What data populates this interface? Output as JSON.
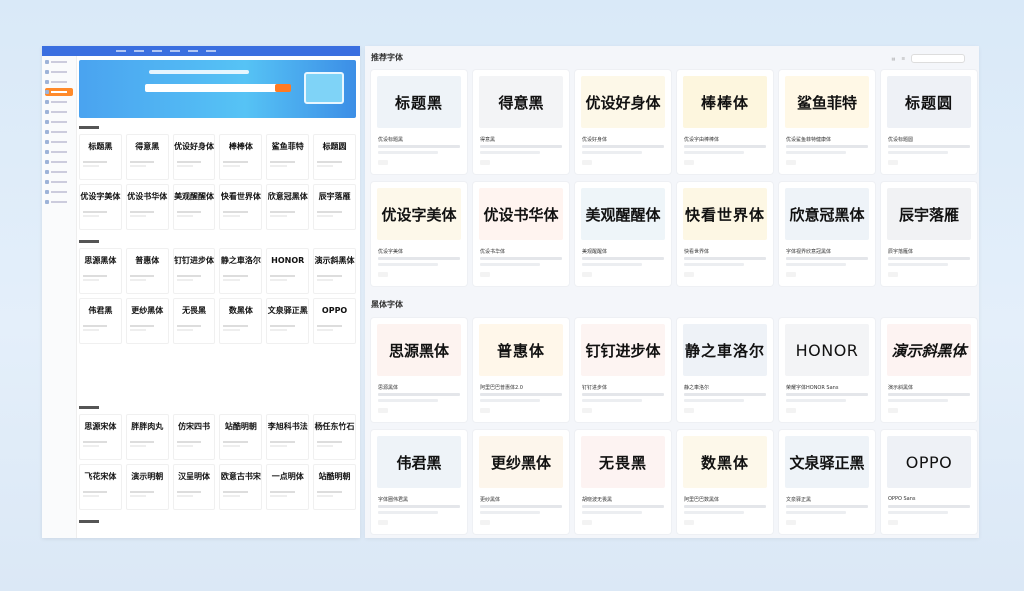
{
  "panel": {
    "section_recommended": "推荐字体",
    "section_heiti": "黑体字体",
    "recommended": [
      {
        "preview": "标题黑",
        "name": "优设标题黑",
        "bg": "#eef3f8",
        "style": "heavy"
      },
      {
        "preview": "得意黑",
        "name": "得意黑",
        "bg": "#f3f4f6",
        "style": "normal"
      },
      {
        "preview": "优设好身体",
        "name": "优设好身体",
        "bg": "#fdf8e8",
        "style": "normal"
      },
      {
        "preview": "棒棒体",
        "name": "优设字由棒棒体",
        "bg": "#fdf6de",
        "style": "heavy"
      },
      {
        "preview": "鲨鱼菲特",
        "name": "优设鲨鱼菲特健康体",
        "bg": "#fff8e6",
        "style": "normal"
      },
      {
        "preview": "标题圆",
        "name": "优设标题圆",
        "bg": "#eef1f6",
        "style": "heavy"
      },
      {
        "preview": "优设字美体",
        "name": "优设字美体",
        "bg": "#fdf8ea",
        "style": "serif"
      },
      {
        "preview": "优设书华体",
        "name": "优设书华体",
        "bg": "#fff4f0",
        "style": "serif"
      },
      {
        "preview": "美观醒醒体",
        "name": "美观醒醒体",
        "bg": "#eef5f9",
        "style": "normal"
      },
      {
        "preview": "快看世界体",
        "name": "快看世界体",
        "bg": "#fdf7e4",
        "style": "heavy"
      },
      {
        "preview": "欣意冠黑体",
        "name": "字体视界欣意冠黑体",
        "bg": "#eef3f8",
        "style": "normal"
      },
      {
        "preview": "辰宇落雁",
        "name": "辰宇落雁体",
        "bg": "#f1f2f4",
        "style": "serif"
      }
    ],
    "heiti": [
      {
        "preview": "思源黑体",
        "name": "思源黑体",
        "bg": "#fdf3f0",
        "style": "normal"
      },
      {
        "preview": "普惠体",
        "name": "阿里巴巴普惠体2.0",
        "bg": "#fff7ea",
        "style": "heavy"
      },
      {
        "preview": "钉钉进步体",
        "name": "钉钉进步体",
        "bg": "#fdf4f2",
        "style": "normal"
      },
      {
        "preview": "静之車洛尔",
        "name": "静之車洛尔",
        "bg": "#eef2f7",
        "style": "heavy"
      },
      {
        "preview": "HONOR",
        "name": "荣耀字体HONOR Sans",
        "bg": "#f3f4f6",
        "style": "latin"
      },
      {
        "preview": "演示斜黑体",
        "name": "演示斜黑体",
        "bg": "#fdf3f2",
        "style": "italic"
      },
      {
        "preview": "伟君黑",
        "name": "字体圈伟君黑",
        "bg": "#eef3f8",
        "style": "normal"
      },
      {
        "preview": "更纱黑体",
        "name": "更纱黑体",
        "bg": "#fdf6ec",
        "style": "normal"
      },
      {
        "preview": "无畏黑",
        "name": "胡晓波无畏黑",
        "bg": "#fdf3f2",
        "style": "heavy"
      },
      {
        "preview": "数黑体",
        "name": "阿里巴巴数黑体",
        "bg": "#fdf8ea",
        "style": "heavy"
      },
      {
        "preview": "文泉驿正黑",
        "name": "文泉驿正黑",
        "bg": "#eef3f8",
        "style": "normal"
      },
      {
        "preview": "OPPO",
        "name": "OPPO Sans",
        "bg": "#eef1f6",
        "style": "latin"
      }
    ]
  },
  "mini": {
    "row1": [
      "标题黑",
      "得意黑",
      "优设好身体",
      "棒棒体",
      "鲨鱼菲特",
      "标题圆"
    ],
    "row2": [
      "优设字美体",
      "优设书华体",
      "美观醒醒体",
      "快看世界体",
      "欣意冠黑体",
      "辰宇落雁"
    ],
    "row3": [
      "思源黑体",
      "普惠体",
      "钉钉进步体",
      "静之車洛尔",
      "HONOR",
      "演示斜黑体"
    ],
    "row4": [
      "伟君黑",
      "更纱黑体",
      "无畏黑",
      "数黑体",
      "文泉驿正黑",
      "OPPO"
    ],
    "row5": [
      "思源宋体",
      "胖胖肉丸",
      "仿宋四书",
      "站酷明朝",
      "李旭科书法",
      "杨任东竹石"
    ],
    "row6": [
      "飞花宋体",
      "演示明朝",
      "汉呈明体",
      "欧意古书宋",
      "一点明体",
      "站酷明朝"
    ]
  }
}
